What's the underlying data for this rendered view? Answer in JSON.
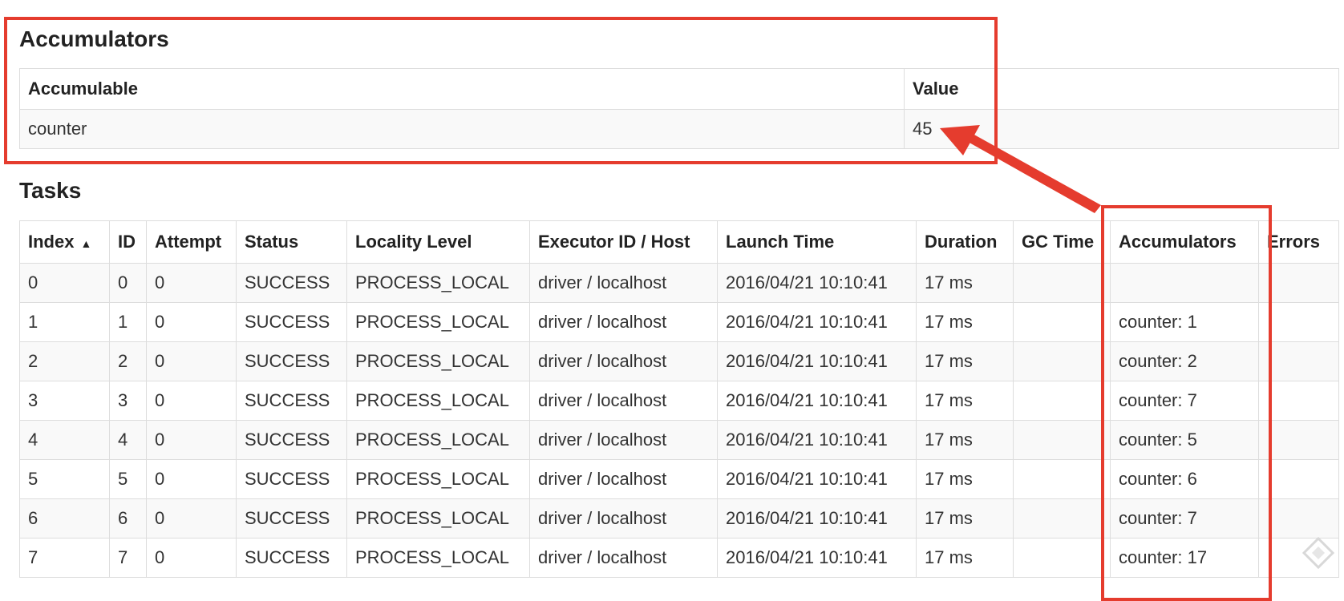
{
  "accumulators": {
    "title": "Accumulators",
    "headers": [
      "Accumulable",
      "Value"
    ],
    "rows": [
      [
        "counter",
        "45"
      ]
    ]
  },
  "tasks": {
    "title": "Tasks",
    "sort_indicator": "▲",
    "headers": [
      "Index",
      "ID",
      "Attempt",
      "Status",
      "Locality Level",
      "Executor ID / Host",
      "Launch Time",
      "Duration",
      "GC Time",
      "Accumulators",
      "Errors"
    ],
    "rows": [
      [
        "0",
        "0",
        "0",
        "SUCCESS",
        "PROCESS_LOCAL",
        "driver / localhost",
        "2016/04/21 10:10:41",
        "17 ms",
        "",
        "",
        ""
      ],
      [
        "1",
        "1",
        "0",
        "SUCCESS",
        "PROCESS_LOCAL",
        "driver / localhost",
        "2016/04/21 10:10:41",
        "17 ms",
        "",
        "counter: 1",
        ""
      ],
      [
        "2",
        "2",
        "0",
        "SUCCESS",
        "PROCESS_LOCAL",
        "driver / localhost",
        "2016/04/21 10:10:41",
        "17 ms",
        "",
        "counter: 2",
        ""
      ],
      [
        "3",
        "3",
        "0",
        "SUCCESS",
        "PROCESS_LOCAL",
        "driver / localhost",
        "2016/04/21 10:10:41",
        "17 ms",
        "",
        "counter: 7",
        ""
      ],
      [
        "4",
        "4",
        "0",
        "SUCCESS",
        "PROCESS_LOCAL",
        "driver / localhost",
        "2016/04/21 10:10:41",
        "17 ms",
        "",
        "counter: 5",
        ""
      ],
      [
        "5",
        "5",
        "0",
        "SUCCESS",
        "PROCESS_LOCAL",
        "driver / localhost",
        "2016/04/21 10:10:41",
        "17 ms",
        "",
        "counter: 6",
        ""
      ],
      [
        "6",
        "6",
        "0",
        "SUCCESS",
        "PROCESS_LOCAL",
        "driver / localhost",
        "2016/04/21 10:10:41",
        "17 ms",
        "",
        "counter: 7",
        ""
      ],
      [
        "7",
        "7",
        "0",
        "SUCCESS",
        "PROCESS_LOCAL",
        "driver / localhost",
        "2016/04/21 10:10:41",
        "17 ms",
        "",
        "counter: 17",
        ""
      ]
    ]
  },
  "annotation": {
    "highlight_color": "#e53c2e",
    "watermark_icon": "diamond-logo-icon"
  }
}
